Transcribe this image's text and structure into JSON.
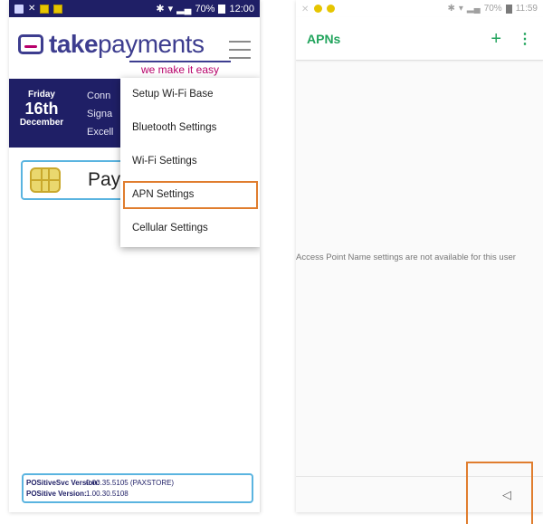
{
  "left_screen": {
    "status_bar": {
      "battery": "70%",
      "time": "12:00"
    },
    "header": {
      "brand_bold": "take",
      "brand_light": "payments",
      "tagline": "we make it easy"
    },
    "date": {
      "day": "Friday",
      "date": "16th",
      "month": "December"
    },
    "status_lines": [
      "Conn",
      "Signa",
      "Excell"
    ],
    "pay_card": {
      "label": "Pay"
    },
    "menu": {
      "items": [
        {
          "label": "Setup Wi-Fi Base"
        },
        {
          "label": "Bluetooth Settings"
        },
        {
          "label": "Wi-Fi Settings"
        },
        {
          "label": "APN Settings",
          "highlighted": true
        },
        {
          "label": "Cellular Settings"
        }
      ]
    },
    "versions": [
      {
        "label": "POSitiveSvc Version:",
        "value": "0.00.35.5105 (PAXSTORE)"
      },
      {
        "label": "POSitive Version:",
        "value": "1.00.30.5108"
      }
    ],
    "colors": {
      "brand_navy": "#1f1f66",
      "brand_magenta": "#b8006a",
      "highlight": "#e07d2e",
      "card_border": "#5ab4e0"
    }
  },
  "right_screen": {
    "status_bar": {
      "battery": "70%",
      "time": "11:59"
    },
    "app_bar": {
      "title": "APNs",
      "add_icon": "+",
      "more_icon": "⋮"
    },
    "message": "Access Point Name settings are not available for this user",
    "nav": {
      "back_icon": "◁"
    },
    "colors": {
      "accent": "#22a45d",
      "highlight": "#e07d2e"
    }
  }
}
